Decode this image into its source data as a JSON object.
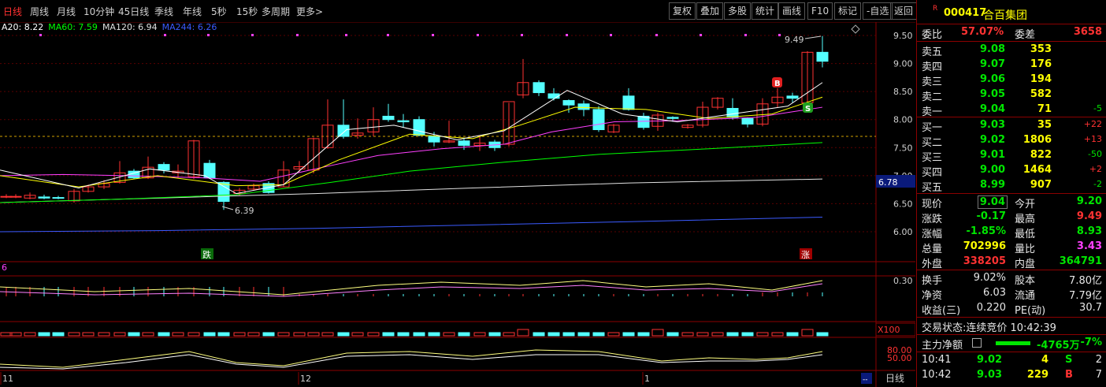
{
  "toolbar": {
    "periods": [
      "日线",
      "周线",
      "月线",
      "10分钟",
      "45日线",
      "季线",
      "年线",
      "5秒",
      "15秒",
      "多周期",
      "更多>"
    ],
    "active_period": "日线",
    "right_buttons": [
      "复权",
      "叠加",
      "多股",
      "统计",
      "画线",
      "F10",
      "标记",
      "-自选",
      "返回"
    ]
  },
  "ma_row": [
    {
      "text": "A20: 8.22",
      "color": "#ffffff"
    },
    {
      "text": "MA60: 7.59",
      "color": "#00ff00"
    },
    {
      "text": "MA120: 6.94",
      "color": "#e0e0e0"
    },
    {
      "text": "MA244: 6.26",
      "color": "#3b5bff"
    }
  ],
  "price_axis": [
    "9.50",
    "9.00",
    "8.50",
    "8.00",
    "7.50",
    "7.00",
    "6.50",
    "6.00"
  ],
  "current_price_tag": "6.78",
  "annotations": {
    "high": "9.49",
    "low": "6.39",
    "b_mark": "B",
    "s_mark": "S",
    "down_mark": "跌",
    "up_mark": "涨"
  },
  "vol_panel": {
    "left_label": "6",
    "right_value": "0.30"
  },
  "x100_label": "X100",
  "kdj_axis": [
    "80.00",
    "50.00"
  ],
  "time_axis": {
    "labels": [
      "11",
      "12",
      "1"
    ],
    "period_button": "日线"
  },
  "stock": {
    "badge": "R",
    "code": "000417",
    "name": "合百集团"
  },
  "order_book": {
    "weibi_label": "委比",
    "weibi": "57.07%",
    "weicha_label": "委差",
    "weicha": "3658",
    "asks": [
      {
        "label": "卖五",
        "price": "9.08",
        "vol": "353",
        "chg": ""
      },
      {
        "label": "卖四",
        "price": "9.07",
        "vol": "176",
        "chg": ""
      },
      {
        "label": "卖三",
        "price": "9.06",
        "vol": "194",
        "chg": ""
      },
      {
        "label": "卖二",
        "price": "9.05",
        "vol": "582",
        "chg": ""
      },
      {
        "label": "卖一",
        "price": "9.04",
        "vol": "71",
        "chg": "-5"
      }
    ],
    "bids": [
      {
        "label": "买一",
        "price": "9.03",
        "vol": "35",
        "chg": "+22"
      },
      {
        "label": "买二",
        "price": "9.02",
        "vol": "1806",
        "chg": "+13"
      },
      {
        "label": "买三",
        "price": "9.01",
        "vol": "822",
        "chg": "-50"
      },
      {
        "label": "买四",
        "price": "9.00",
        "vol": "1464",
        "chg": "+2"
      },
      {
        "label": "买五",
        "price": "8.99",
        "vol": "907",
        "chg": "-2"
      }
    ]
  },
  "quote": {
    "xianjia_l": "现价",
    "xianjia": "9.04",
    "jinkai_l": "今开",
    "jinkai": "9.20",
    "zhangdie_l": "涨跌",
    "zhangdie": "-0.17",
    "zuigao_l": "最高",
    "zuigao": "9.49",
    "zhangfu_l": "涨幅",
    "zhangfu": "-1.85%",
    "zuidi_l": "最低",
    "zuidi": "8.93",
    "zongliang_l": "总量",
    "zongliang": "702996",
    "liangbi_l": "量比",
    "liangbi": "3.43",
    "waipan_l": "外盘",
    "waipan": "338205",
    "neipan_l": "内盘",
    "neipan": "364791",
    "huanshou_l": "换手",
    "huanshou": "9.02%",
    "guben_l": "股本",
    "guben": "7.80亿",
    "jingzi_l": "净资",
    "jingzi": "6.03",
    "liutong_l": "流通",
    "liutong": "7.79亿",
    "shouyi_l": "收益(三)",
    "shouyi": "0.220",
    "pe_l": "PE(动)",
    "pe": "30.7",
    "status": "交易状态:连续竞价 10:42:39",
    "zhuli_l": "主力净额",
    "zhuli": "-4765万",
    "zhuli_pct": "-7%"
  },
  "ticks": [
    {
      "time": "10:41",
      "price": "9.02",
      "vol": "4",
      "side": "S",
      "n": "2"
    },
    {
      "time": "10:42",
      "price": "9.03",
      "vol": "229",
      "side": "B",
      "n": "7"
    }
  ],
  "colors": {
    "up": "#ff3232",
    "down": "#54ffff",
    "ma5": "#ffffff",
    "ma10": "#ffff00",
    "ma20": "#ff40ff",
    "ma60": "#00ff00",
    "ma120": "#e0e0e0",
    "ma244": "#3b5bff"
  }
}
